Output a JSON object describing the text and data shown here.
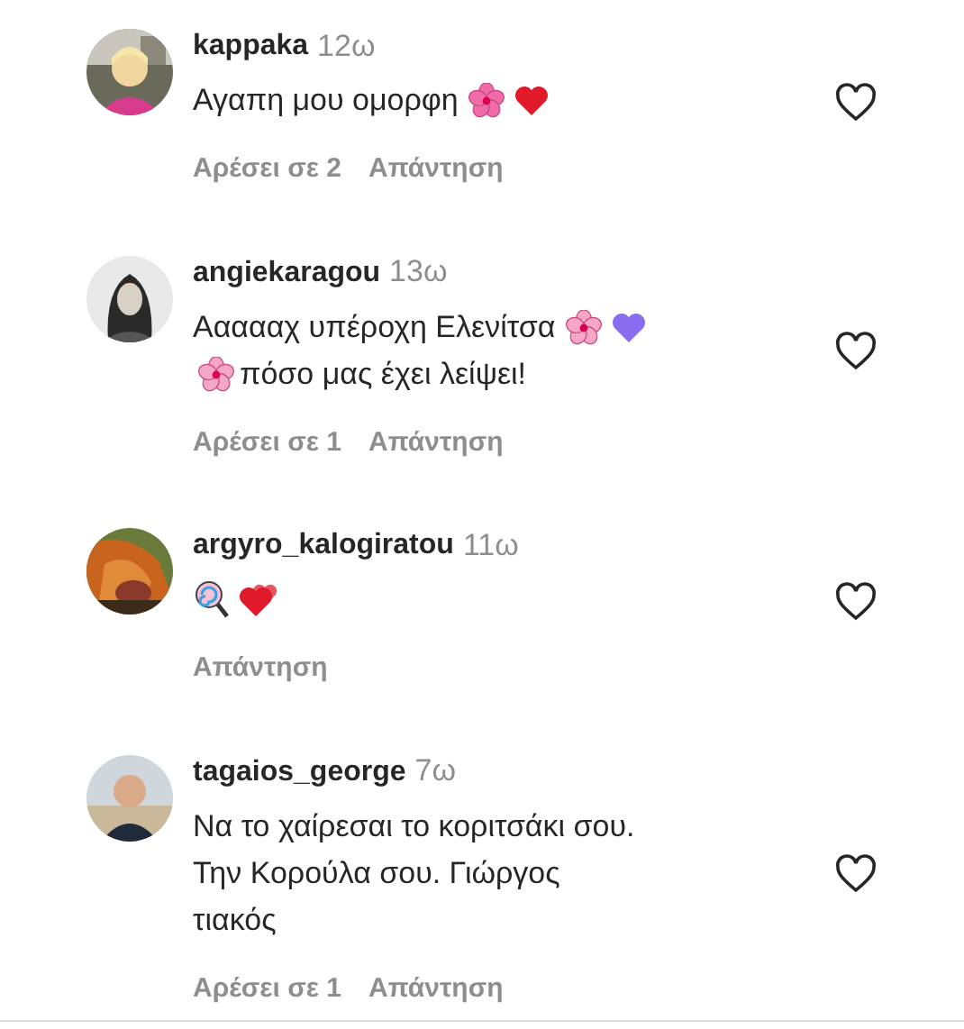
{
  "comments": [
    {
      "avatar": {
        "kind": "picture"
      },
      "username": "kappaka",
      "time": "12ω",
      "lines": [
        [
          {
            "kind": "text",
            "text": "Αγαπη μου ομορφη"
          },
          {
            "kind": "flower",
            "color": "#f06ba8"
          },
          {
            "kind": "heart",
            "color": "#e0192b"
          }
        ]
      ],
      "likes": "Αρέσει σε 2",
      "reply": "Απάντηση",
      "liked": false
    },
    {
      "avatar": {
        "kind": "picture"
      },
      "username": "angiekaragou",
      "time": "13ω",
      "lines": [
        [
          {
            "kind": "text",
            "text": "Αααααχ υπέροχη Ελενίτσα"
          },
          {
            "kind": "flower",
            "color": "#f7a6c8"
          },
          {
            "kind": "heart",
            "color": "#8a6cf0"
          }
        ],
        [
          {
            "kind": "flower",
            "color": "#f7a6c8"
          },
          {
            "kind": "text",
            "text": "πόσο μας έχει λείψει!"
          }
        ]
      ],
      "likes": "Αρέσει σε 1",
      "reply": "Απάντηση",
      "liked": false
    },
    {
      "avatar": {
        "kind": "picture"
      },
      "username": "argyro_kalogiratou",
      "time": "11ω",
      "lines": [
        [
          {
            "kind": "lollipop"
          },
          {
            "kind": "hearts",
            "color": "#e0192b"
          }
        ]
      ],
      "reply": "Απάντηση",
      "liked": false
    },
    {
      "avatar": {
        "kind": "picture"
      },
      "username": "tagaios_george",
      "time": "7ω",
      "lines": [
        [
          {
            "kind": "text",
            "text": "Να το χαίρεσαι το κοριτσάκι σου."
          }
        ],
        [
          {
            "kind": "text",
            "text": "Την Κορούλα σου. Γιώργος"
          }
        ],
        [
          {
            "kind": "text",
            "text": "τιακός"
          }
        ]
      ],
      "likes": "Αρέσει σε 1",
      "reply": "Απάντηση",
      "liked": false
    }
  ]
}
